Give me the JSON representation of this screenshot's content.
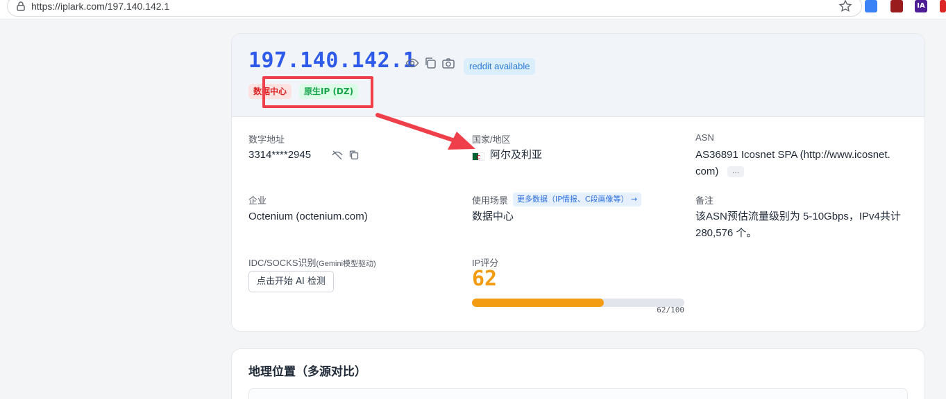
{
  "browser": {
    "url": "https://iplark.com/197.140.142.1"
  },
  "ip_card": {
    "ip": "197.140.142.1",
    "reddit_badge": "reddit available",
    "tags": [
      {
        "label": "数据中心",
        "color": "#dc2626"
      },
      {
        "label": "原生IP (DZ)",
        "color": "#16a34a"
      }
    ],
    "numeric_address": {
      "label": "数字地址",
      "value": "3314****2945"
    },
    "country": {
      "label": "国家/地区",
      "value": "阿尔及利亚"
    },
    "asn": {
      "label": "ASN",
      "value_line1": "AS36891 Icosnet SPA (http://www.icosnet.",
      "value_line2": "com)",
      "more": "..."
    },
    "company": {
      "label": "企业",
      "value": "Octenium (octenium.com)"
    },
    "usage": {
      "label": "使用场景",
      "more_link": "更多数据（IP情报、C段画像等） →",
      "value": "数据中心"
    },
    "note": {
      "label": "备注",
      "value_line1": "该ASN预估流量级别为 5-10Gbps，IPv4共计",
      "value_line2": "280,576 个。"
    },
    "idc": {
      "label": "IDC/SOCKS识别",
      "sub": "(Gemini模型驱动)",
      "button": "点击开始 AI 检测"
    },
    "score": {
      "label": "IP评分",
      "value": "62",
      "fraction": 0.62,
      "text": "62/100",
      "color": "#f39c12"
    }
  },
  "geo_card": {
    "title": "地理位置（多源对比）"
  },
  "annotation": {
    "color": "#ee3f4a"
  }
}
